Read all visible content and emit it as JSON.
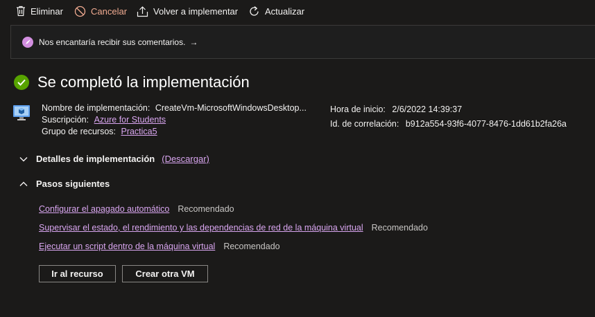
{
  "toolbar": {
    "delete_label": "Eliminar",
    "delete_icon": "trash-icon",
    "cancel_label": "Cancelar",
    "cancel_icon": "cancel-icon",
    "redeploy_label": "Volver a implementar",
    "redeploy_icon": "upload-icon",
    "refresh_label": "Actualizar",
    "refresh_icon": "refresh-icon"
  },
  "banner": {
    "text": "Nos encantaría recibir sus comentarios.",
    "arrow": "→",
    "icon": "rocket-icon"
  },
  "status": {
    "title": "Se completó la implementación",
    "icon": "success-check-icon",
    "color": "#57a300"
  },
  "details": {
    "name_label": "Nombre de implementación:",
    "name_value": "CreateVm-MicrosoftWindowsDesktop...",
    "subscription_label": "Suscripción:",
    "subscription_value": "Azure for Students",
    "resource_group_label": "Grupo de recursos:",
    "resource_group_value": "Practica5",
    "start_time_label": "Hora de inicio:",
    "start_time_value": "2/6/2022 14:39:37",
    "correlation_label": "Id. de correlación:",
    "correlation_value": "b912a554-93f6-4077-8476-1dd61b2fa26a"
  },
  "sections": {
    "deployment_details": "Detalles de implementación",
    "download": "(Descargar)",
    "next_steps": "Pasos siguientes"
  },
  "next_steps": [
    {
      "link": "Configurar el apagado automático",
      "tag": "Recomendado"
    },
    {
      "link": "Supervisar el estado, el rendimiento y las dependencias de red de la máquina virtual",
      "tag": "Recomendado"
    },
    {
      "link": "Ejecutar un script dentro de la máquina virtual",
      "tag": "Recomendado"
    }
  ],
  "buttons": {
    "go_to_resource": "Ir al recurso",
    "create_vm": "Crear otra VM"
  },
  "colors": {
    "background": "#1b1a19",
    "link": "#d9a6f0",
    "cancel": "#f1ab91",
    "banner_icon": "#d38fe0"
  }
}
